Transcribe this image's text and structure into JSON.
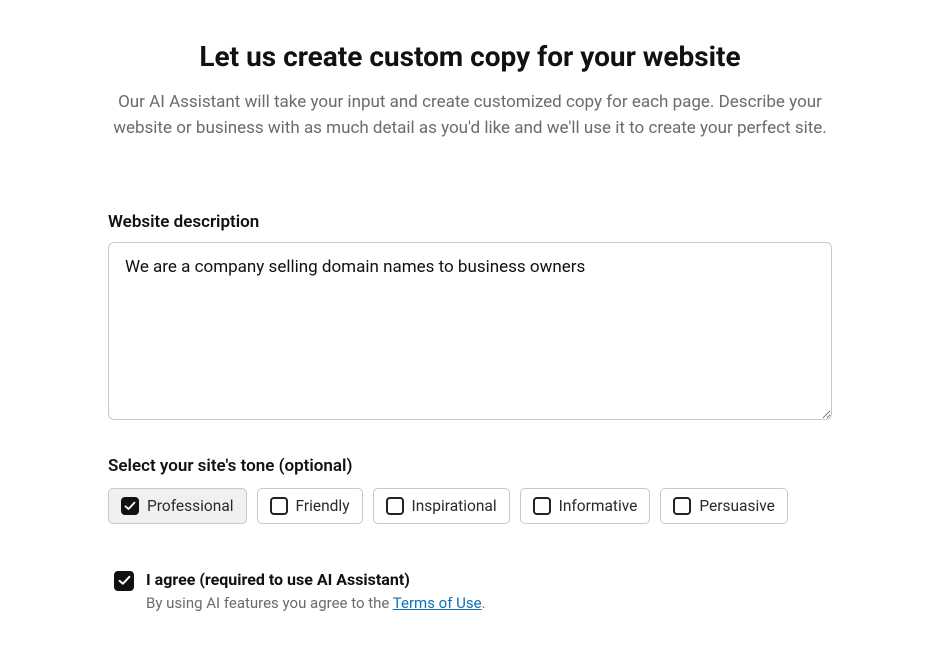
{
  "header": {
    "title": "Let us create custom copy for your website",
    "subtitle": "Our AI Assistant will take your input and create customized copy for each page. Describe your website or business with as much detail as you'd like and we'll use it to create your perfect site."
  },
  "description": {
    "label": "Website description",
    "value": "We are a company selling domain names to business owners"
  },
  "tone": {
    "label": "Select your site's tone (optional)",
    "options": [
      {
        "label": "Professional",
        "checked": true
      },
      {
        "label": "Friendly",
        "checked": false
      },
      {
        "label": "Inspirational",
        "checked": false
      },
      {
        "label": "Informative",
        "checked": false
      },
      {
        "label": "Persuasive",
        "checked": false
      }
    ]
  },
  "agree": {
    "checked": true,
    "label": "I agree (required to use AI Assistant)",
    "subtext_prefix": "By using AI features you agree to the ",
    "link_text": "Terms of Use",
    "subtext_suffix": "."
  }
}
